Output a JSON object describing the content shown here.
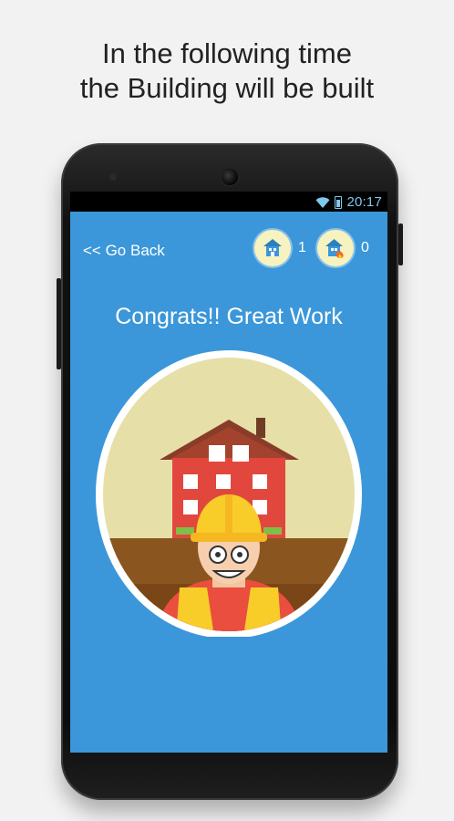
{
  "promo": {
    "line1": "In the following time",
    "line2": "the Building will be built"
  },
  "status_bar": {
    "time": "20:17",
    "icons": [
      "wifi-icon",
      "battery-charging-icon"
    ],
    "color": "#7ec8ee"
  },
  "app": {
    "go_back_label": "<< Go Back",
    "counters": [
      {
        "icon": "house-icon",
        "value": "1"
      },
      {
        "icon": "house-fire-icon",
        "value": "0"
      }
    ],
    "message": "Congrats!! Great Work",
    "illustration": "builder-and-house-illustration"
  },
  "colors": {
    "background": "#f2f2f2",
    "screen": "#3b97d9",
    "badge": "#f6f3c0",
    "house": "#e2473e",
    "ground": "#8b5520",
    "helmet": "#f8cd2a"
  }
}
